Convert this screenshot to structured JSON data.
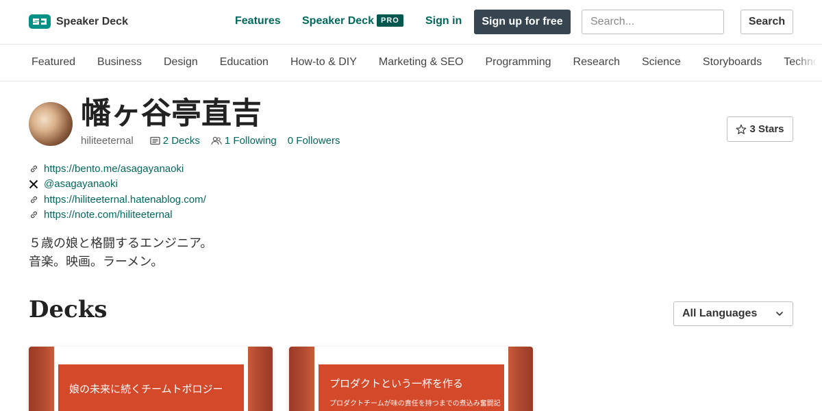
{
  "header": {
    "logo_text": "Speaker Deck",
    "nav": {
      "features": "Features",
      "speakerdeck_pro": "Speaker Deck",
      "pro_badge": "PRO",
      "signin": "Sign in",
      "signup": "Sign up for free"
    },
    "search": {
      "placeholder": "Search...",
      "button": "Search"
    }
  },
  "categories": [
    "Featured",
    "Business",
    "Design",
    "Education",
    "How-to & DIY",
    "Marketing & SEO",
    "Programming",
    "Research",
    "Science",
    "Storyboards",
    "Technology"
  ],
  "profile": {
    "name": "幡ヶ谷亭直吉",
    "username": "hiliteeternal",
    "decks": "2 Decks",
    "following": "1 Following",
    "followers": "0 Followers",
    "stars": "3 Stars",
    "links": [
      {
        "icon": "link-icon",
        "text": "https://bento.me/asagayanaoki"
      },
      {
        "icon": "x-icon",
        "text": "@asagayanaoki"
      },
      {
        "icon": "link-icon",
        "text": "https://hiliteeternal.hatenablog.com/"
      },
      {
        "icon": "link-icon",
        "text": "https://note.com/hiliteeternal"
      }
    ],
    "bio": [
      "５歳の娘と格闘するエンジニア。",
      "音楽。映画。ラーメン。"
    ]
  },
  "decks": {
    "title": "Decks",
    "language_filter": "All Languages",
    "items": [
      {
        "title": "娘の未来に続くチームトポロジー",
        "subtitle": ""
      },
      {
        "title": "プロダクトという一杯を作る",
        "subtitle": "プロダクトチームが味の責任を持つまでの煮込み奮闘記"
      }
    ]
  },
  "colors": {
    "accent": "#00695c",
    "signup_bg": "#36454f",
    "deck_red": "#d4492a"
  }
}
